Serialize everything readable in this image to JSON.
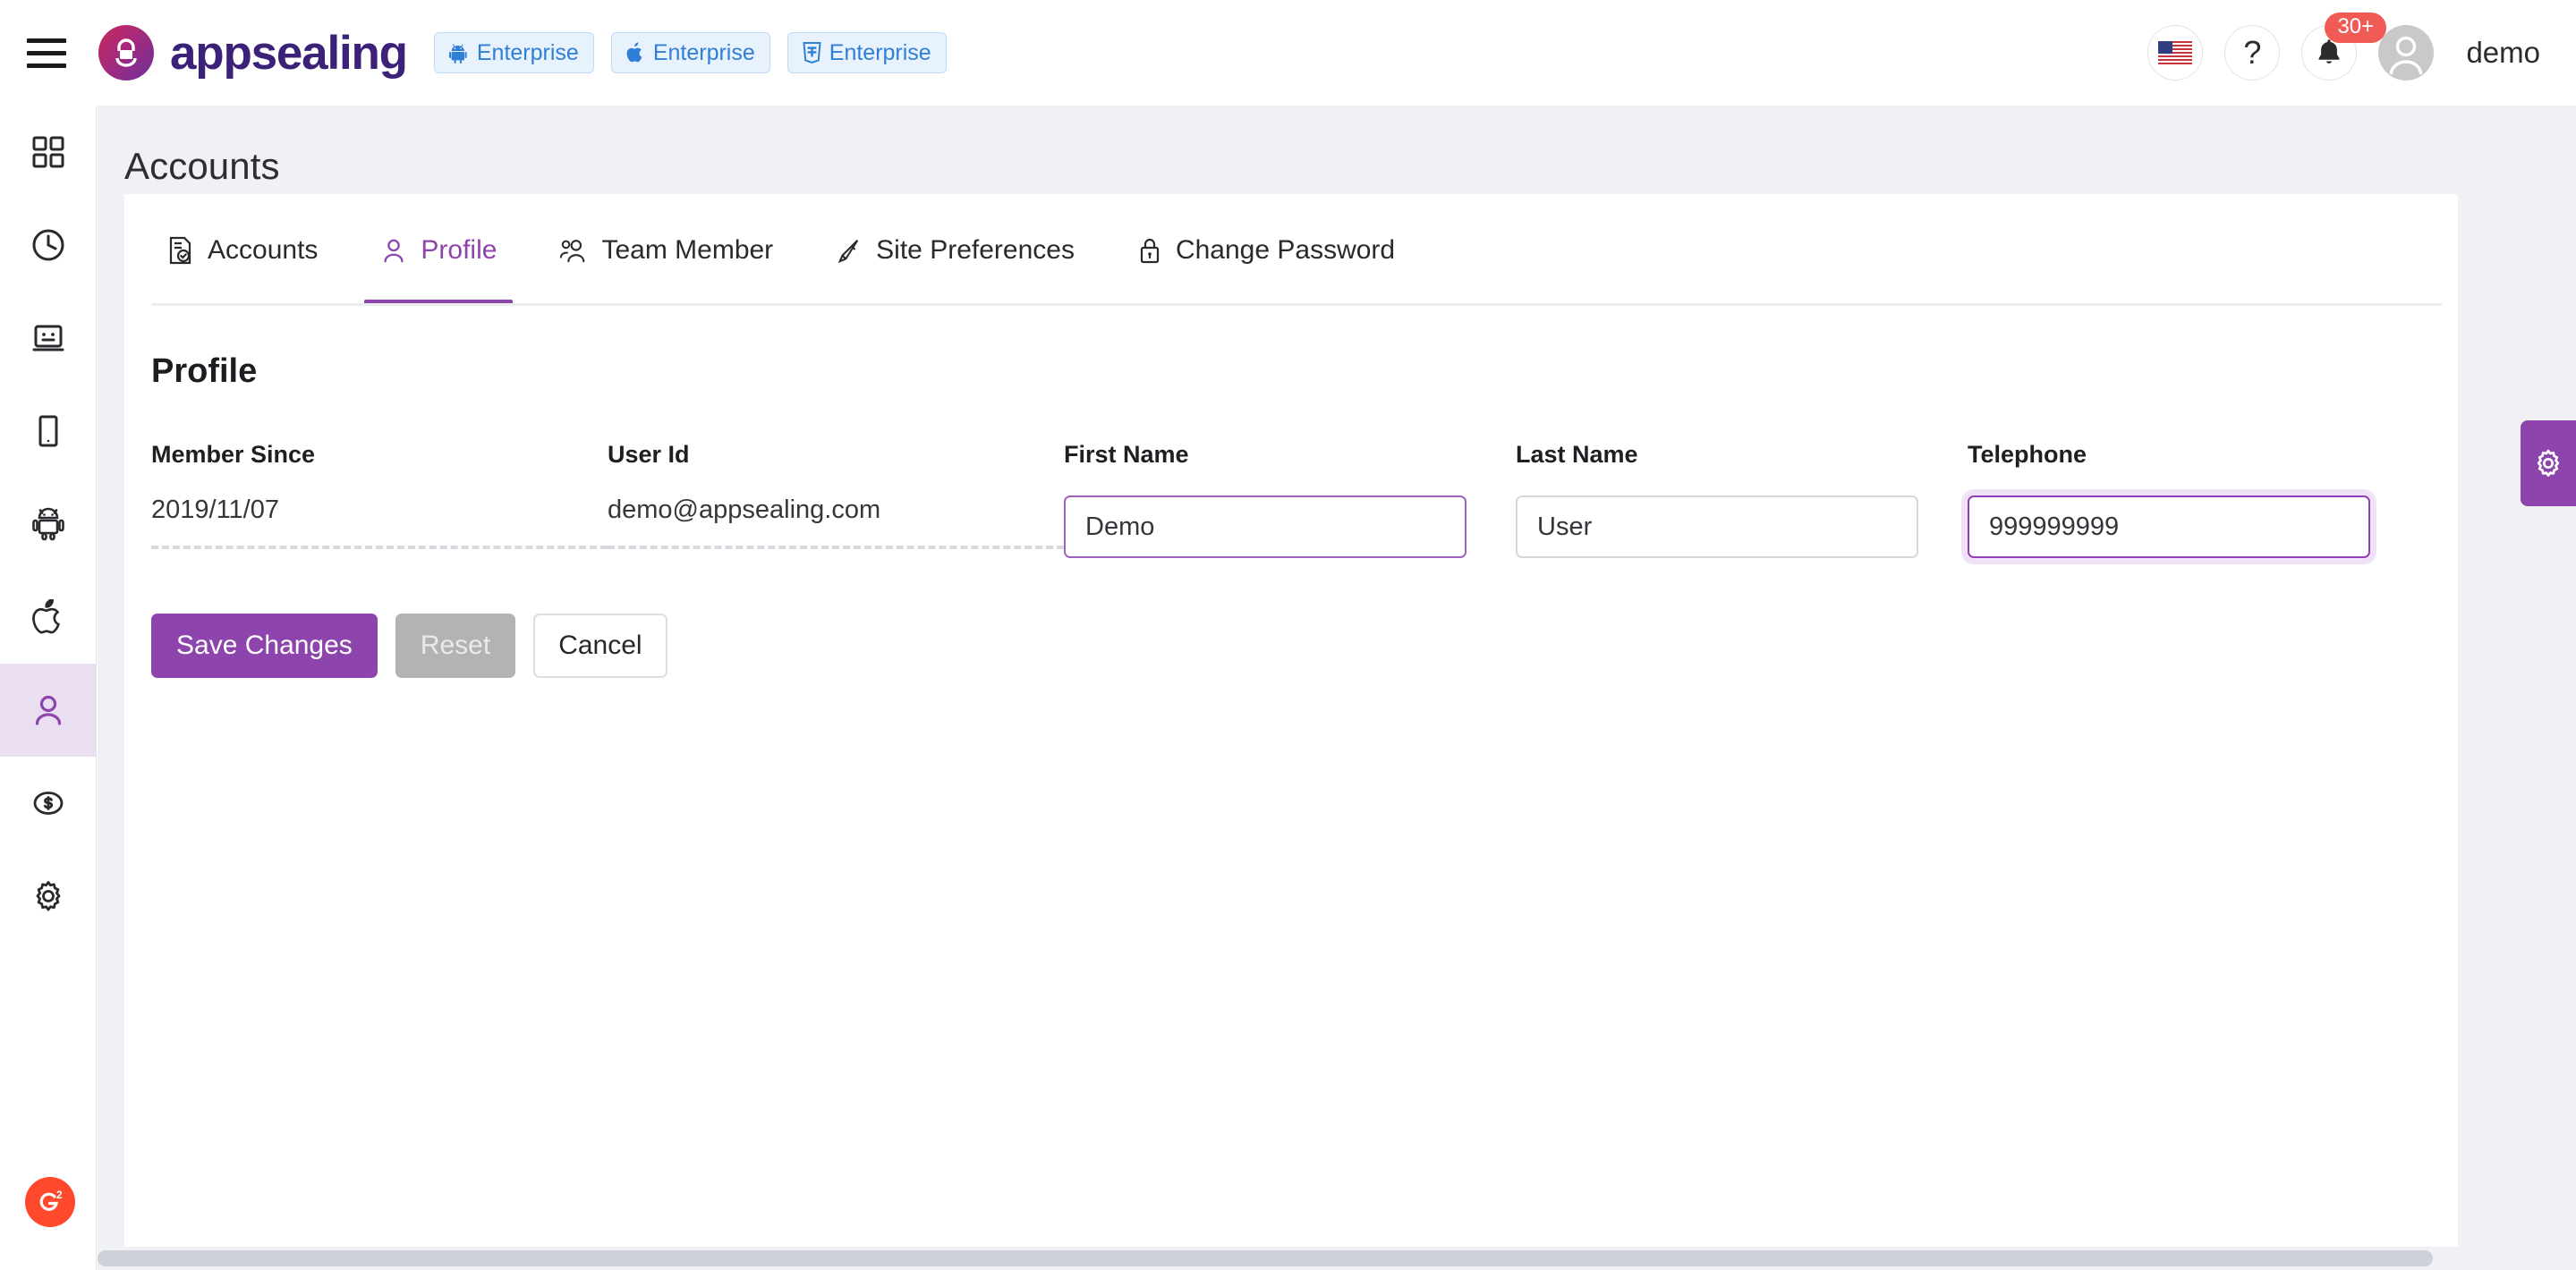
{
  "header": {
    "menu_icon": "hamburger-menu-icon",
    "brand": {
      "logo_icon": "appsealing-shield-lock-logo",
      "name": "appsealing"
    },
    "badges": [
      {
        "icon": "android-icon",
        "label": "Enterprise"
      },
      {
        "icon": "apple-icon",
        "label": "Enterprise"
      },
      {
        "icon": "html5-icon",
        "label": "Enterprise"
      }
    ],
    "language_icon": "us-flag-icon",
    "help_icon": "question-mark-icon",
    "notifications": {
      "icon": "bell-icon",
      "count": "30+"
    },
    "account": {
      "avatar_icon": "user-avatar-icon",
      "username": "demo"
    }
  },
  "sidebar": {
    "items": [
      {
        "icon": "dashboard-grid-icon",
        "active": false
      },
      {
        "icon": "clock-history-icon",
        "active": false
      },
      {
        "icon": "monitor-face-icon",
        "active": false
      },
      {
        "icon": "mobile-device-icon",
        "active": false
      },
      {
        "icon": "android-robot-icon",
        "active": false
      },
      {
        "icon": "apple-icon",
        "active": false
      },
      {
        "icon": "user-profile-icon",
        "active": true
      },
      {
        "icon": "dollar-coin-icon",
        "active": false
      },
      {
        "icon": "gear-settings-icon",
        "active": false
      }
    ],
    "g2_badge": {
      "icon": "g2-review-badge",
      "label": "G"
    }
  },
  "page": {
    "title": "Accounts"
  },
  "tabs": [
    {
      "label": "Accounts",
      "icon": "document-check-icon",
      "active": false
    },
    {
      "label": "Profile",
      "icon": "user-icon",
      "active": true
    },
    {
      "label": "Team Member",
      "icon": "team-members-icon",
      "active": false
    },
    {
      "label": "Site Preferences",
      "icon": "pen-tool-icon",
      "active": false
    },
    {
      "label": "Change Password",
      "icon": "lock-icon",
      "active": false
    }
  ],
  "profile": {
    "section_title": "Profile",
    "fields": [
      {
        "label": "Member Since",
        "value": "2019/11/07",
        "type": "static"
      },
      {
        "label": "User Id",
        "value": "demo@appsealing.com",
        "type": "static"
      },
      {
        "label": "First Name",
        "value": "Demo",
        "type": "input",
        "state": "accented"
      },
      {
        "label": "Last Name",
        "value": "User",
        "type": "input",
        "state": "normal"
      },
      {
        "label": "Telephone",
        "value": "999999999",
        "type": "input",
        "state": "focused"
      }
    ],
    "buttons": {
      "save": "Save Changes",
      "reset": "Reset",
      "cancel": "Cancel"
    }
  },
  "floating": {
    "gear_icon": "settings-gear-icon"
  },
  "colors": {
    "accent_purple": "#8e44ad",
    "badge_blue": "#2f7fd6",
    "badge_blue_bg": "#e8f2fd",
    "notif_red": "#f05b55",
    "page_bg": "#f0f1f5",
    "g2_red": "#ff492c"
  }
}
